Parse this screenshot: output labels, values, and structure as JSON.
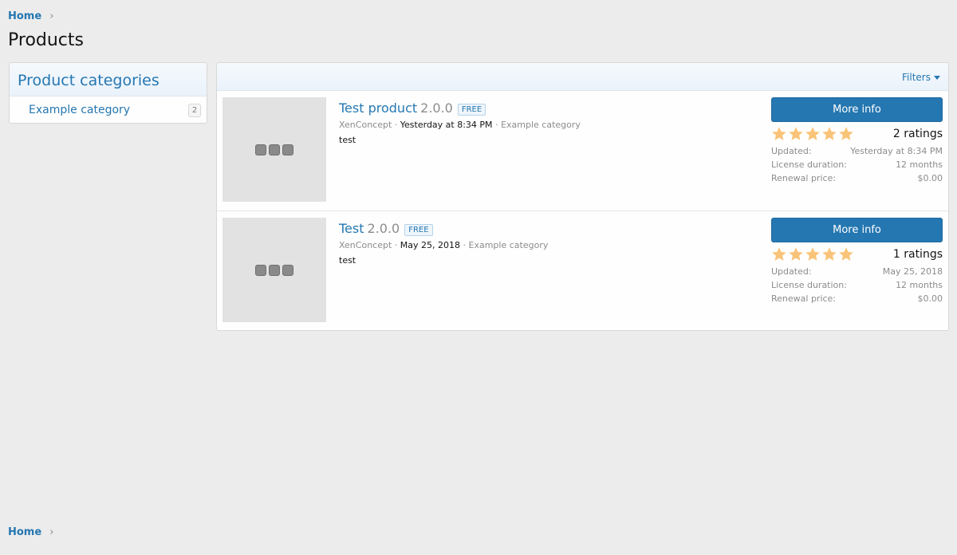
{
  "breadcrumb": {
    "home": "Home",
    "separator": "›"
  },
  "page": {
    "title": "Products"
  },
  "sidebar": {
    "title": "Product categories",
    "categories": [
      {
        "label": "Example category",
        "count": "2"
      }
    ]
  },
  "main": {
    "filters_label": "Filters"
  },
  "products": [
    {
      "title": "Test product",
      "version": "2.0.0",
      "badge": "FREE",
      "author": "XenConcept",
      "sep1": "·",
      "date": "Yesterday at 8:34 PM",
      "sep2": "·",
      "category": "Example category",
      "description": "test",
      "button": "More info",
      "rating_text": "2 ratings",
      "rating_value": 5,
      "updated_label": "Updated:",
      "updated_value": "Yesterday at 8:34 PM",
      "license_label": "License duration:",
      "license_value": "12 months",
      "renewal_label": "Renewal price:",
      "renewal_value": "$0.00"
    },
    {
      "title": "Test",
      "version": "2.0.0",
      "badge": "FREE",
      "author": "XenConcept",
      "sep1": "·",
      "date": "May 25, 2018",
      "sep2": "·",
      "category": "Example category",
      "description": "test",
      "button": "More info",
      "rating_text": "1 ratings",
      "rating_value": 5,
      "updated_label": "Updated:",
      "updated_value": "May 25, 2018",
      "license_label": "License duration:",
      "license_value": "12 months",
      "renewal_label": "Renewal price:",
      "renewal_value": "$0.00"
    }
  ],
  "colors": {
    "accent": "#2577b1",
    "star": "#f9c479",
    "background": "#ececec"
  },
  "icons": {
    "star": "star-icon",
    "thumbnail": "placeholder-image-icon",
    "filter_caret": "caret-down-icon"
  }
}
